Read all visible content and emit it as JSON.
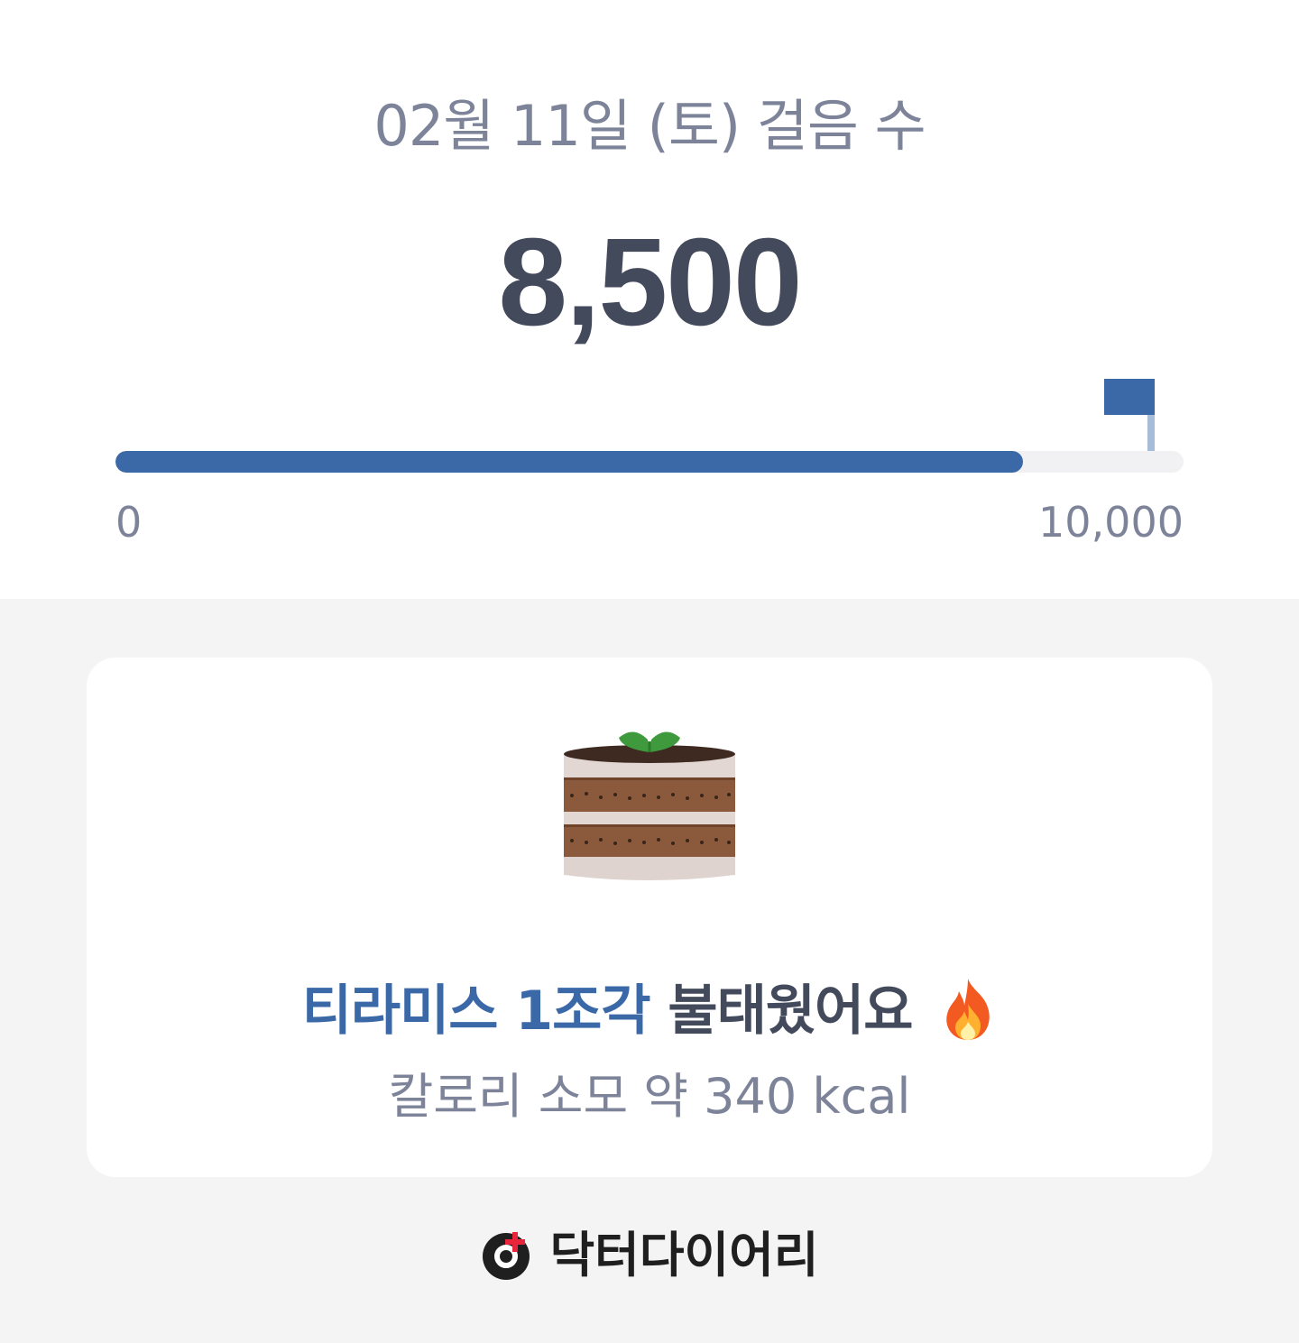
{
  "header": {
    "date_title": "02월 11일 (토) 걸음 수",
    "steps": "8,500"
  },
  "progress": {
    "current": 8500,
    "goal": 10000,
    "fraction": 0.85,
    "min_label": "0",
    "max_label": "10,000",
    "accent_color": "#3b69a8"
  },
  "card": {
    "food_icon": "tiramisu-cake-icon",
    "food_text": "티라미스 1조각",
    "burn_text": "불태웠어요",
    "emoji_icon": "fire-icon",
    "calorie_text": "칼로리 소모 약 340 kcal"
  },
  "brand": {
    "name": "닥터다이어리"
  }
}
